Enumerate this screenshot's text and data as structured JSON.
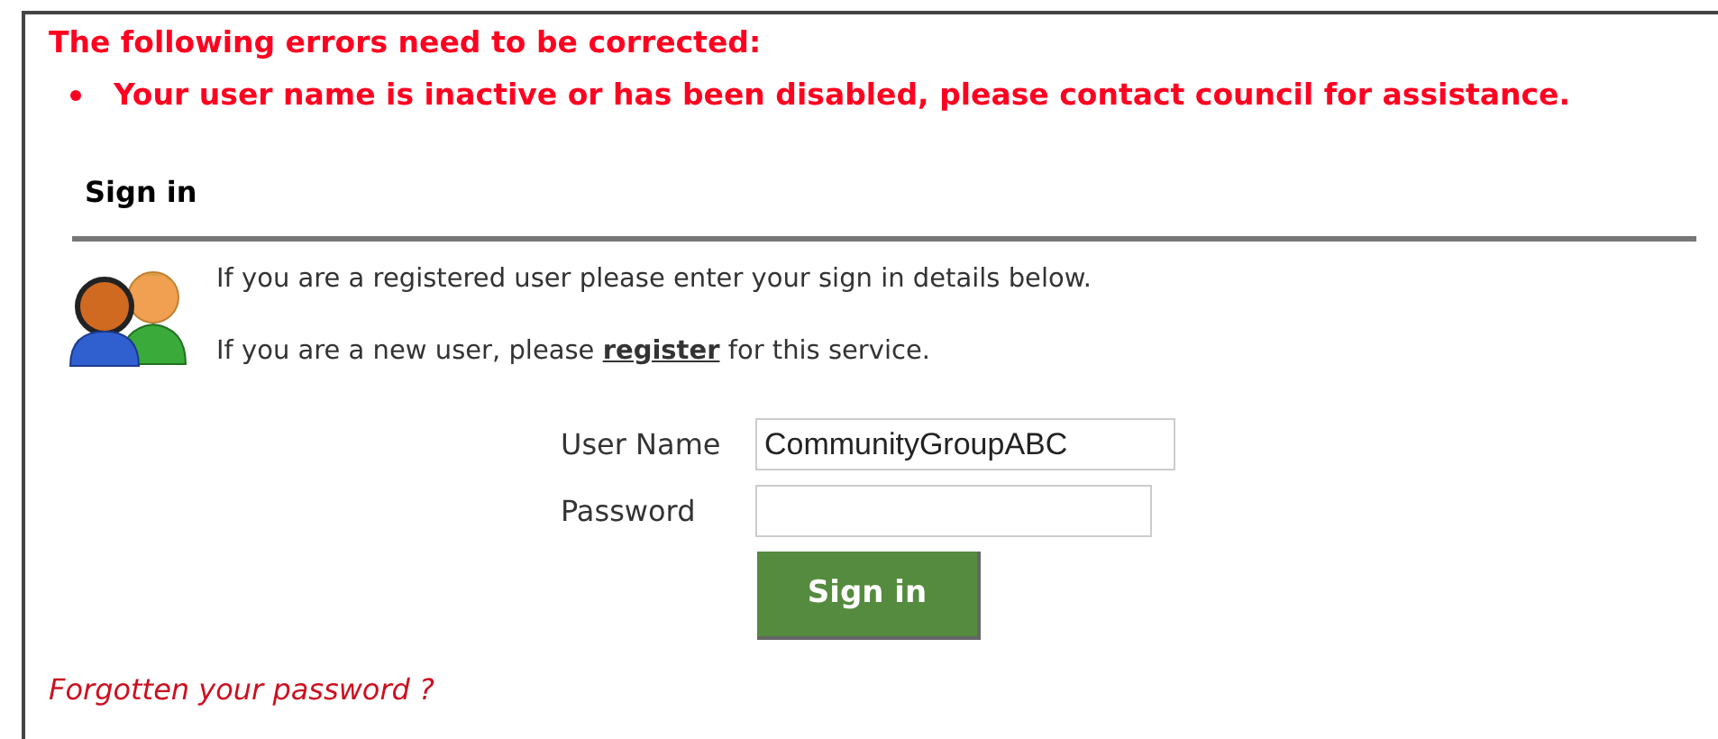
{
  "errors": {
    "title": "The following errors need to be corrected:",
    "items": [
      "Your user name is inactive or has been disabled, please contact council for assistance."
    ]
  },
  "sign_in": {
    "heading": "Sign in",
    "intro": "If you are a registered user please enter your sign in details below.",
    "new_user": {
      "before": "If you are a new user, please ",
      "link": "register",
      "after": " for this service."
    },
    "fields": [
      {
        "label": "User Name",
        "value": "CommunityGroupABC"
      },
      {
        "label": "Password"
      }
    ],
    "button": "Sign in",
    "forgot": "Forgotten your password ?"
  }
}
